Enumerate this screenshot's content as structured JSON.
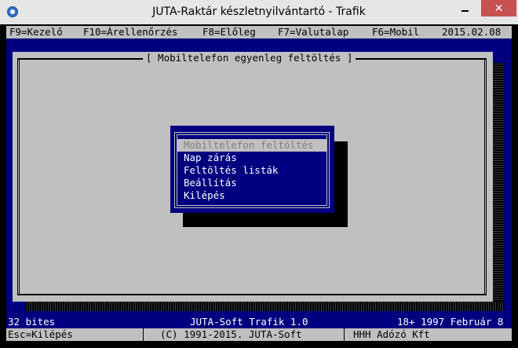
{
  "window": {
    "title": "JUTA-Raktár készletnyilvántartó - Trafik",
    "minimize": "",
    "maximize": "",
    "close": "✕"
  },
  "topbar": {
    "items": [
      "F9=Kezelő",
      "F10=Árellenőrzés",
      "F8=Előleg",
      "F7=Valutalap",
      "F6=Mobil"
    ],
    "date": "2015.02.08"
  },
  "panel": {
    "title": "[ Mobiltelefon egyenleg feltöltés ]"
  },
  "menu": {
    "items": [
      {
        "label": "Mobiltelefon feltöltés",
        "selected": true
      },
      {
        "label": "Nap zárás",
        "selected": false
      },
      {
        "label": "Feltöltés listák",
        "selected": false
      },
      {
        "label": "Beállítás",
        "selected": false
      },
      {
        "label": "Kilépés",
        "selected": false
      }
    ]
  },
  "status": {
    "left": "32 bites",
    "center": "JUTA-Soft Trafik 1.0",
    "right": "18+ 1997 Február 8"
  },
  "footer": {
    "left": "Esc=Kilépés",
    "center": "(C) 1991-2015. JUTA-Soft",
    "right": "HHH Adózó Kft"
  },
  "colors": {
    "console_blue": "#000080",
    "console_gray": "#c0c0c0",
    "close_red": "#c75050"
  }
}
